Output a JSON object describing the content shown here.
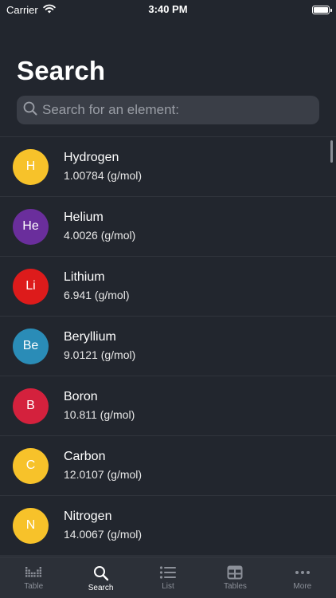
{
  "status_bar": {
    "carrier": "Carrier",
    "time": "3:40 PM"
  },
  "page": {
    "title": "Search"
  },
  "search": {
    "placeholder": "Search for an element:"
  },
  "elements": [
    {
      "symbol": "H",
      "name": "Hydrogen",
      "mass": "1.00784 (g/mol)",
      "color": "#f7c22a"
    },
    {
      "symbol": "He",
      "name": "Helium",
      "mass": "4.0026 (g/mol)",
      "color": "#6a2e9c"
    },
    {
      "symbol": "Li",
      "name": "Lithium",
      "mass": "6.941 (g/mol)",
      "color": "#dd1b1b"
    },
    {
      "symbol": "Be",
      "name": "Beryllium",
      "mass": "9.0121 (g/mol)",
      "color": "#2a8cb7"
    },
    {
      "symbol": "B",
      "name": "Boron",
      "mass": "10.811 (g/mol)",
      "color": "#d4213d"
    },
    {
      "symbol": "C",
      "name": "Carbon",
      "mass": "12.0107 (g/mol)",
      "color": "#f7c22a"
    },
    {
      "symbol": "N",
      "name": "Nitrogen",
      "mass": "14.0067 (g/mol)",
      "color": "#f7c22a"
    }
  ],
  "tab_bar": {
    "tabs": [
      {
        "label": "Table",
        "icon": "table-icon",
        "active": false
      },
      {
        "label": "Search",
        "icon": "search-icon",
        "active": true
      },
      {
        "label": "List",
        "icon": "list-icon",
        "active": false
      },
      {
        "label": "Tables",
        "icon": "grid-icon",
        "active": false
      },
      {
        "label": "More",
        "icon": "more-icon",
        "active": false
      }
    ]
  },
  "colors": {
    "background": "#22262e",
    "search_field": "#3a3e47",
    "tab_bar": "#2c3038",
    "tab_inactive": "#8c9099",
    "tab_active": "#ffffff"
  }
}
